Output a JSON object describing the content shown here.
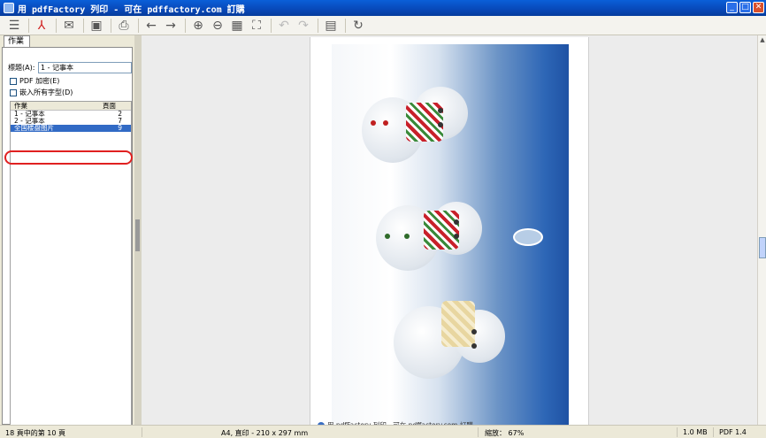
{
  "window": {
    "title": "用 pdfFactory 列印 - 可在 pdffactory.com 訂購"
  },
  "toolbar": {
    "buttons": [
      "menu-icon",
      "pdf-icon",
      "email-icon",
      "save-icon",
      "print-icon",
      "back-icon",
      "forward-icon",
      "zoom-in-icon",
      "zoom-out-icon",
      "thumbnails-icon",
      "fit-page-icon",
      "undo-icon",
      "redo-icon",
      "properties-icon",
      "refresh-icon"
    ]
  },
  "left_panel": {
    "tab_label": "作業",
    "title_label": "標題(A):",
    "title_value": "1 - 记事本",
    "pdf_encrypt_label": "PDF 加密(E)",
    "embed_fonts_label": "嵌入所有字型(D)",
    "list_headers": {
      "job": "作業",
      "pages": "頁面"
    },
    "jobs": [
      {
        "name": "1 - 记事本",
        "pages": "2"
      },
      {
        "name": "2 - 记事本",
        "pages": "7"
      },
      {
        "name": "全国楼盘图片",
        "pages": "9"
      }
    ],
    "annotation_mark": "1"
  },
  "document": {
    "footer": "用 pdfFactory 列印 - 可在 pdffactory.com 訂購"
  },
  "status_bar": {
    "page_info": "18 頁中的第 10 頁",
    "paper": "A4, 直印 - 210 x 297 mm",
    "zoom": "縮放： 67%",
    "size": "1.0 MB",
    "pdf_version": "PDF 1.4"
  }
}
